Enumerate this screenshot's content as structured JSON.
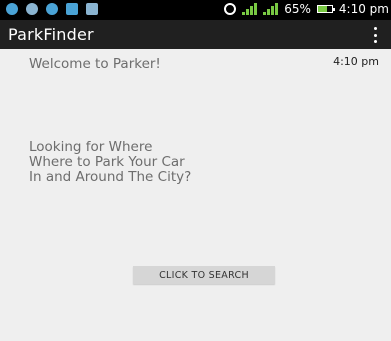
{
  "status_bar": {
    "battery_percent": "65%",
    "time": "4:10 pm",
    "battery_level": 0.65,
    "icons": [
      "notification-icon",
      "notification-icon",
      "notification-icon",
      "mail-icon",
      "chat-icon",
      "alarm-icon",
      "signal-icon",
      "signal-icon",
      "battery-icon"
    ]
  },
  "app_bar": {
    "title": "ParkFinder",
    "menu_icon": "overflow-menu-icon"
  },
  "content": {
    "welcome_text": "Welcome to Parker!",
    "time_text": "4:10 pm",
    "headline_lines": [
      "Looking for Where",
      "Where to Park Your Car",
      "In and Around The City?"
    ],
    "search_button_label": "CLICK TO SEARCH"
  },
  "colors": {
    "background": "#efefef",
    "app_bar": "#202020",
    "status_bar": "#000000",
    "button": "#d6d6d6",
    "signal": "#79c943"
  }
}
